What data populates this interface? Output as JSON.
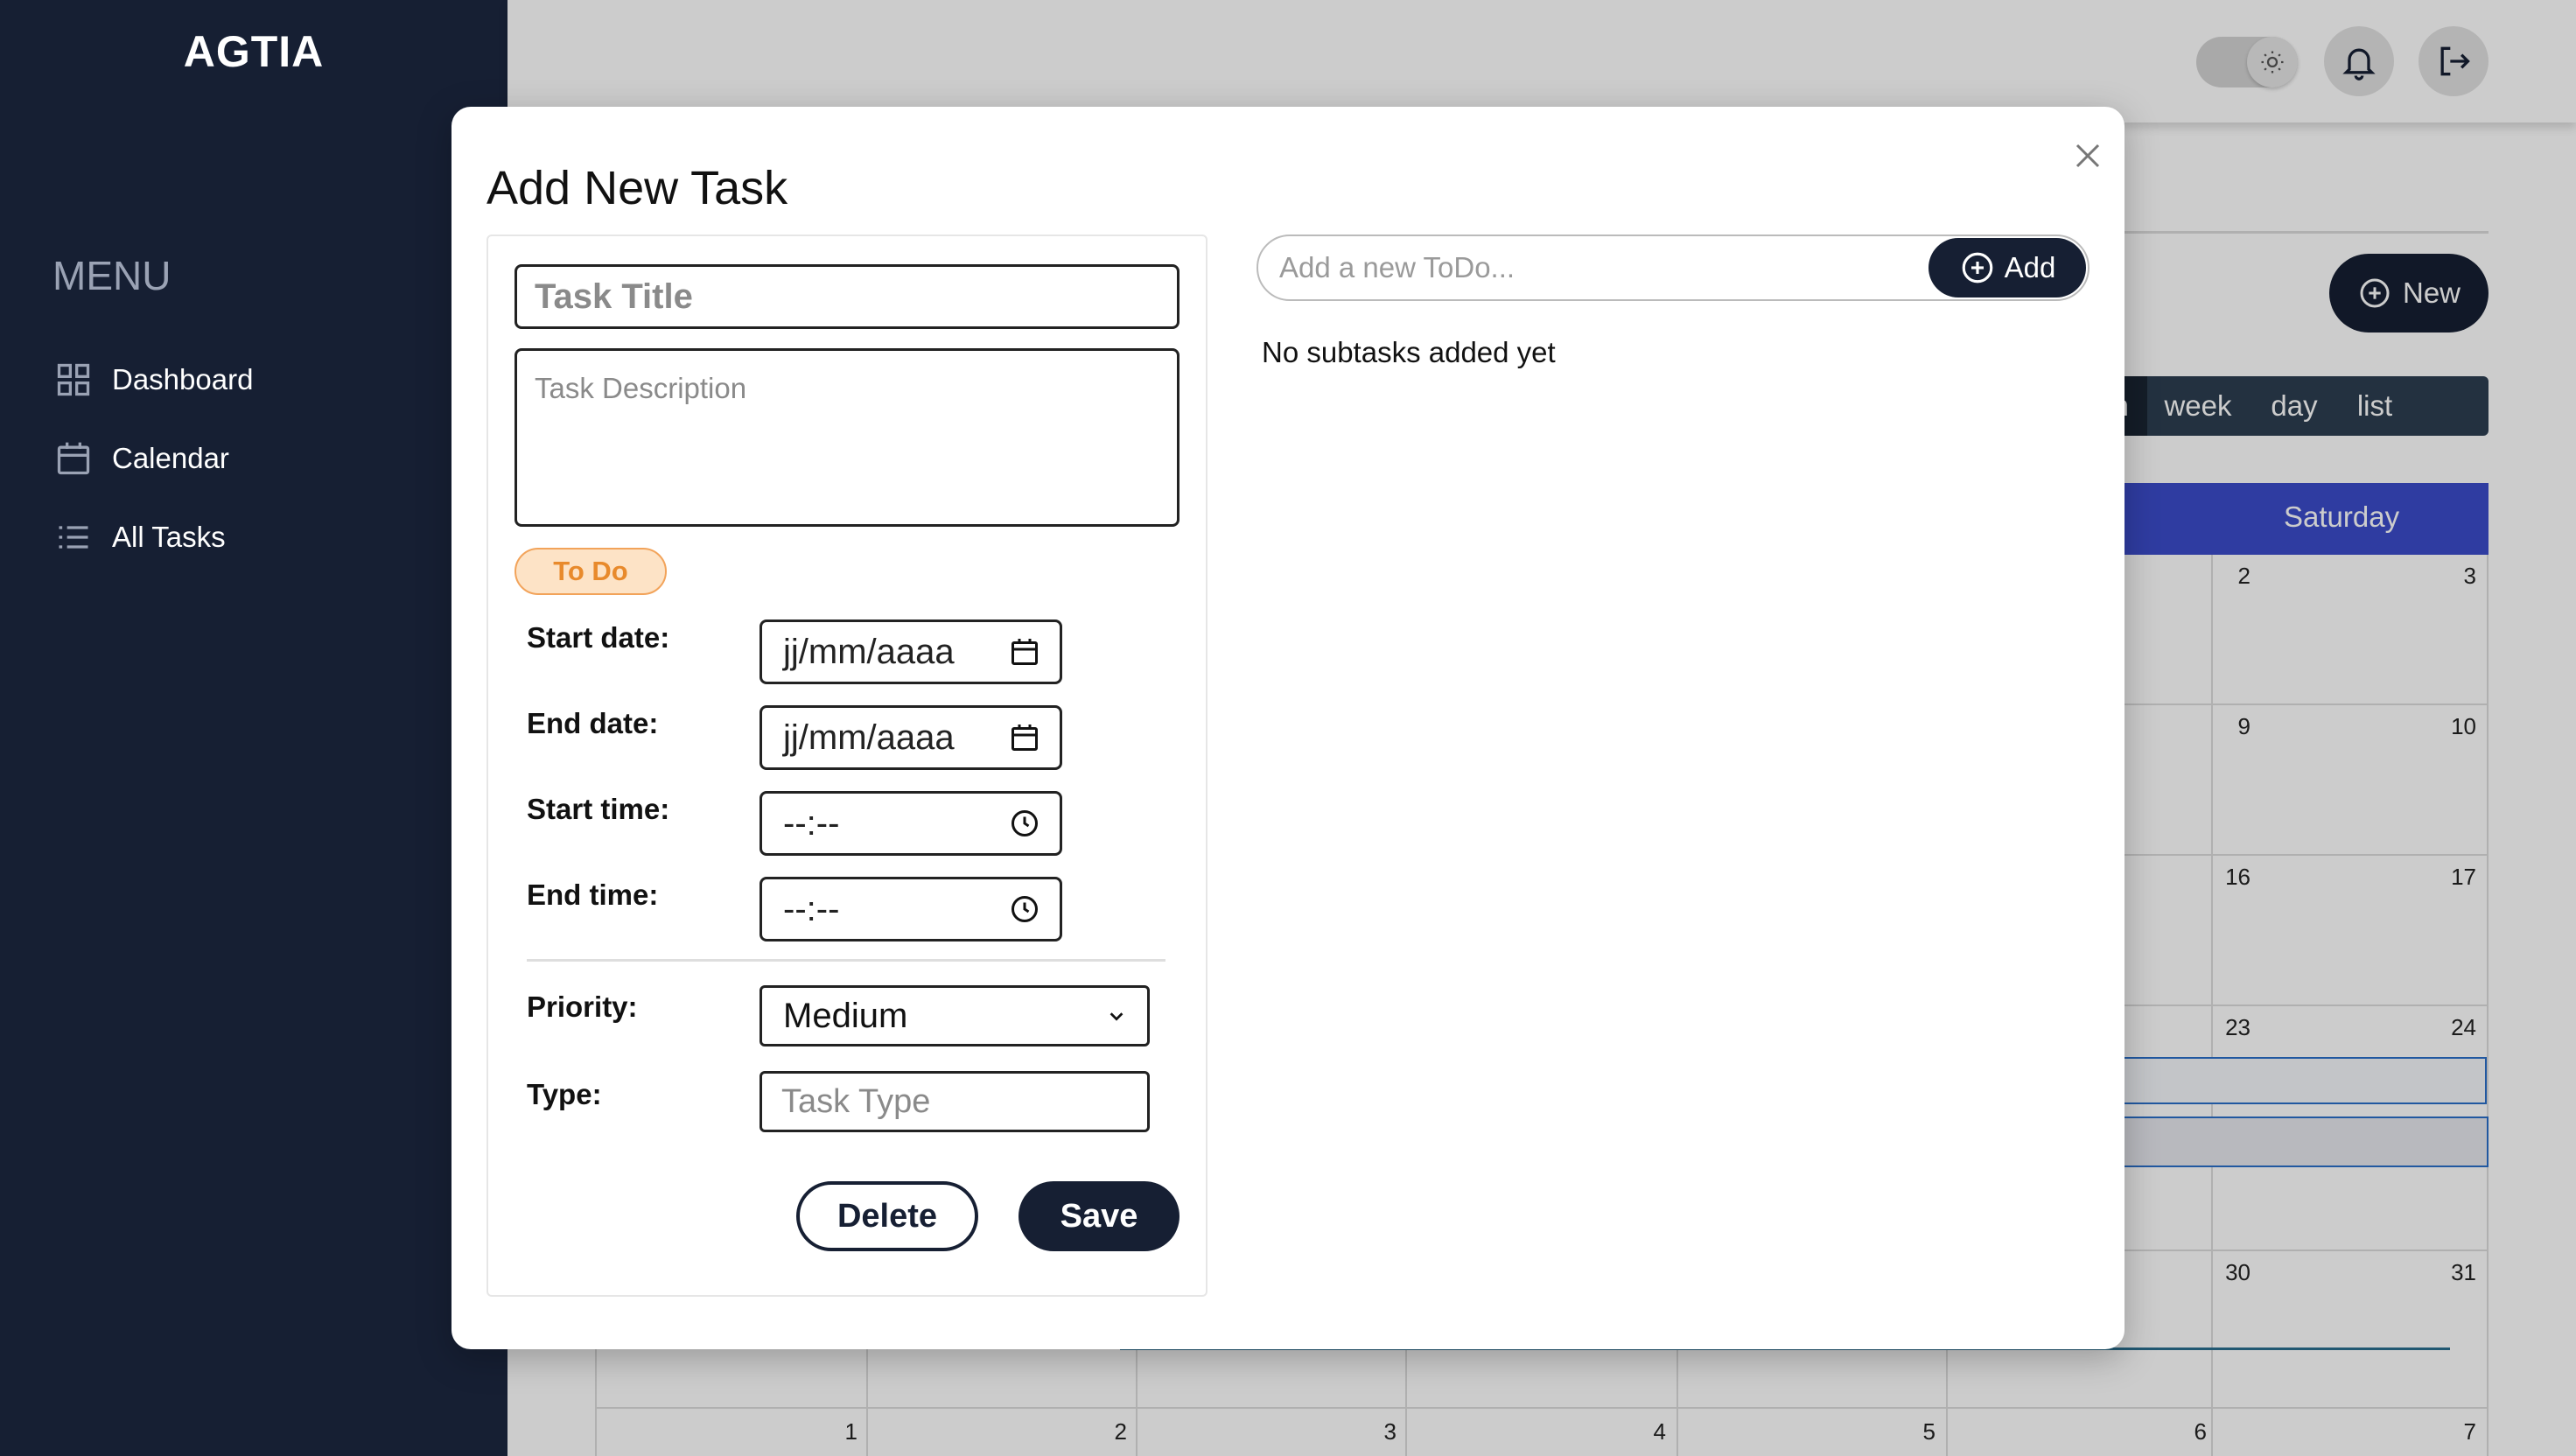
{
  "app": {
    "brand": "AGTIA"
  },
  "sidebar": {
    "menu_title": "MENU",
    "items": [
      {
        "label": "Dashboard",
        "icon": "grid-icon"
      },
      {
        "label": "Calendar",
        "icon": "calendar-icon"
      },
      {
        "label": "All Tasks",
        "icon": "list-icon"
      }
    ]
  },
  "topbar": {
    "theme_icon": "sun-icon",
    "notifications_icon": "bell-icon",
    "logout_icon": "logout-icon"
  },
  "calendar": {
    "new_button": "New",
    "views": [
      "month",
      "week",
      "day",
      "list"
    ],
    "active_view": "month",
    "visible_day_header": "Saturday",
    "day_numbers": [
      "2",
      "3",
      "9",
      "10",
      "16",
      "17",
      "23",
      "24",
      "30",
      "31",
      "1",
      "2",
      "3",
      "4",
      "5",
      "6",
      "7"
    ]
  },
  "modal": {
    "title": "Add New Task",
    "title_placeholder": "Task Title",
    "description_placeholder": "Task Description",
    "status": "To Do",
    "fields": {
      "start_date_label": "Start date:",
      "start_date_value": "jj/mm/aaaa",
      "end_date_label": "End date:",
      "end_date_value": "jj/mm/aaaa",
      "start_time_label": "Start time:",
      "start_time_value": "--:--",
      "end_time_label": "End time:",
      "end_time_value": "--:--",
      "priority_label": "Priority:",
      "priority_value": "Medium",
      "type_label": "Type:",
      "type_placeholder": "Task Type"
    },
    "delete_button": "Delete",
    "save_button": "Save",
    "todo_placeholder": "Add a new ToDo...",
    "todo_add_button": "Add",
    "subtasks_empty": "No subtasks added yet"
  },
  "colors": {
    "sidebar_bg": "#161f33",
    "primary_dark": "#161f33",
    "calendar_header": "#3b4cca",
    "status_badge_bg": "#fde3c6",
    "status_badge_text": "#e88a2c"
  }
}
